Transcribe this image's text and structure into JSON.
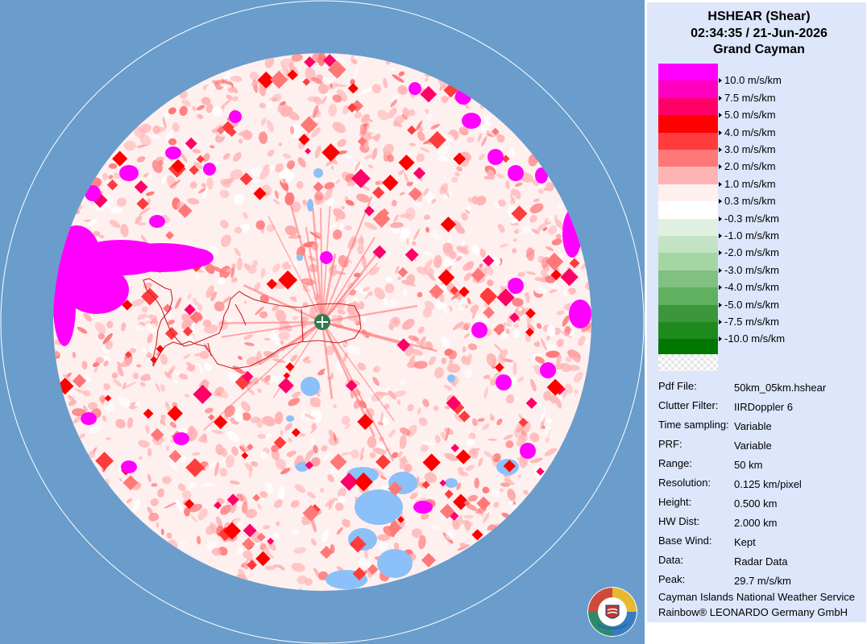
{
  "header": {
    "product": "HSHEAR (Shear)",
    "timestamp": "02:34:35 / 21-Jun-2026",
    "site": "Grand Cayman"
  },
  "legend": [
    {
      "color": "#ff00ff",
      "label": ""
    },
    {
      "color": "#ff00c0",
      "label": "10.0 m/s/km"
    },
    {
      "color": "#ff0068",
      "label": "7.5 m/s/km"
    },
    {
      "color": "#ff0000",
      "label": "5.0 m/s/km"
    },
    {
      "color": "#ff3c3c",
      "label": "4.0 m/s/km"
    },
    {
      "color": "#ff7878",
      "label": "3.0 m/s/km"
    },
    {
      "color": "#ffb4b4",
      "label": "2.0 m/s/km"
    },
    {
      "color": "#fff0f0",
      "label": "1.0 m/s/km"
    },
    {
      "color": "#ffffff",
      "label": "0.3 m/s/km"
    },
    {
      "color": "#e0f0e0",
      "label": "-0.3 m/s/km"
    },
    {
      "color": "#c4e3c4",
      "label": "-1.0 m/s/km"
    },
    {
      "color": "#a4d6a4",
      "label": "-2.0 m/s/km"
    },
    {
      "color": "#80c080",
      "label": "-3.0 m/s/km"
    },
    {
      "color": "#60b060",
      "label": "-4.0 m/s/km"
    },
    {
      "color": "#3c963c",
      "label": "-5.0 m/s/km"
    },
    {
      "color": "#1e8a1e",
      "label": "-7.5 m/s/km"
    },
    {
      "color": "#007800",
      "label": "-10.0 m/s/km"
    }
  ],
  "info": [
    {
      "key": "Pdf File:",
      "value": "50km_05km.hshear"
    },
    {
      "key": "Clutter Filter:",
      "value": "IIRDoppler 6"
    },
    {
      "key": "Time sampling:",
      "value": "Variable"
    },
    {
      "key": "PRF:",
      "value": "Variable"
    },
    {
      "key": "Range:",
      "value": "50 km"
    },
    {
      "key": "Resolution:",
      "value": "0.125 km/pixel"
    },
    {
      "key": "Height:",
      "value": "0.500 km"
    },
    {
      "key": "HW Dist:",
      "value": "2.000 km"
    },
    {
      "key": "Base Wind:",
      "value": "Kept"
    },
    {
      "key": "Data:",
      "value": "Radar Data"
    },
    {
      "key": "Peak:",
      "value": "29.7 m/s/km"
    }
  ],
  "footer": {
    "line1": "Cayman Islands National Weather Service",
    "line2": "Rainbow® LEONARDO Germany GmbH"
  },
  "colors": {
    "ocean": "#6a9ccc",
    "panel": "#dde6fb",
    "no_data": "#8cc0f8",
    "coast": "#cc2222",
    "radar_site": "#2e7d4f"
  },
  "icons": {
    "radar_site": "radar-site-icon",
    "logo": "cinws-logo-icon"
  }
}
